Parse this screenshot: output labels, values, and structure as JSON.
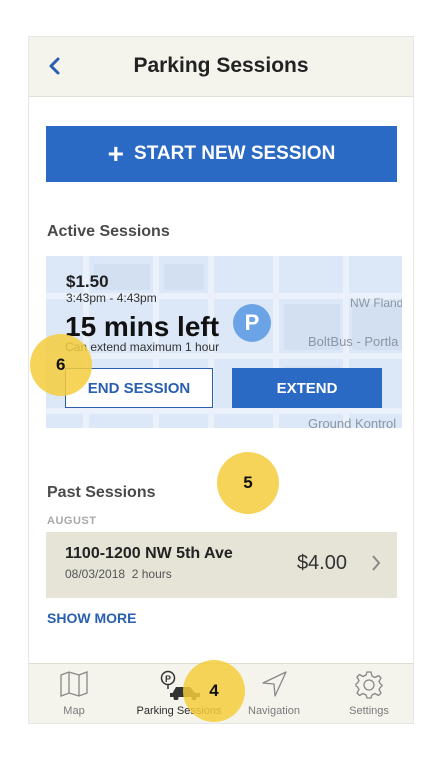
{
  "header": {
    "title": "Parking Sessions",
    "back_icon": "chevron-left-icon"
  },
  "start_button": {
    "label": "START NEW SESSION",
    "icon": "plus-icon"
  },
  "active": {
    "heading": "Active Sessions",
    "price": "$1.50",
    "time_range": "3:43pm - 4:43pm",
    "remaining": "15 mins left",
    "max_note": "Can extend maximum 1 hour",
    "end_label": "END SESSION",
    "extend_label": "EXTEND",
    "map_labels": {
      "street": "NW Flande",
      "poi1": "BoltBus - Portla",
      "poi2": "Ground Kontrol"
    },
    "pin_letter": "P"
  },
  "past": {
    "heading": "Past Sessions",
    "month": "AUGUST",
    "sessions": [
      {
        "address": "1100-1200 NW 5th Ave",
        "date": "08/03/2018",
        "duration": "2 hours",
        "amount": "$4.00"
      }
    ],
    "show_more": "SHOW MORE"
  },
  "annotations": {
    "a4": "4",
    "a5": "5",
    "a6": "6"
  },
  "tabs": [
    {
      "label": "Map",
      "icon": "map-icon"
    },
    {
      "label": "Parking Sessions",
      "icon": "car-parking-icon"
    },
    {
      "label": "Navigation",
      "icon": "navigation-arrow-icon"
    },
    {
      "label": "Settings",
      "icon": "gear-icon"
    }
  ],
  "colors": {
    "primary": "#2a6ac4",
    "header_bg": "#f4f3ec",
    "row_bg": "#e5e4d7",
    "annotation": "#f5cd3c"
  }
}
